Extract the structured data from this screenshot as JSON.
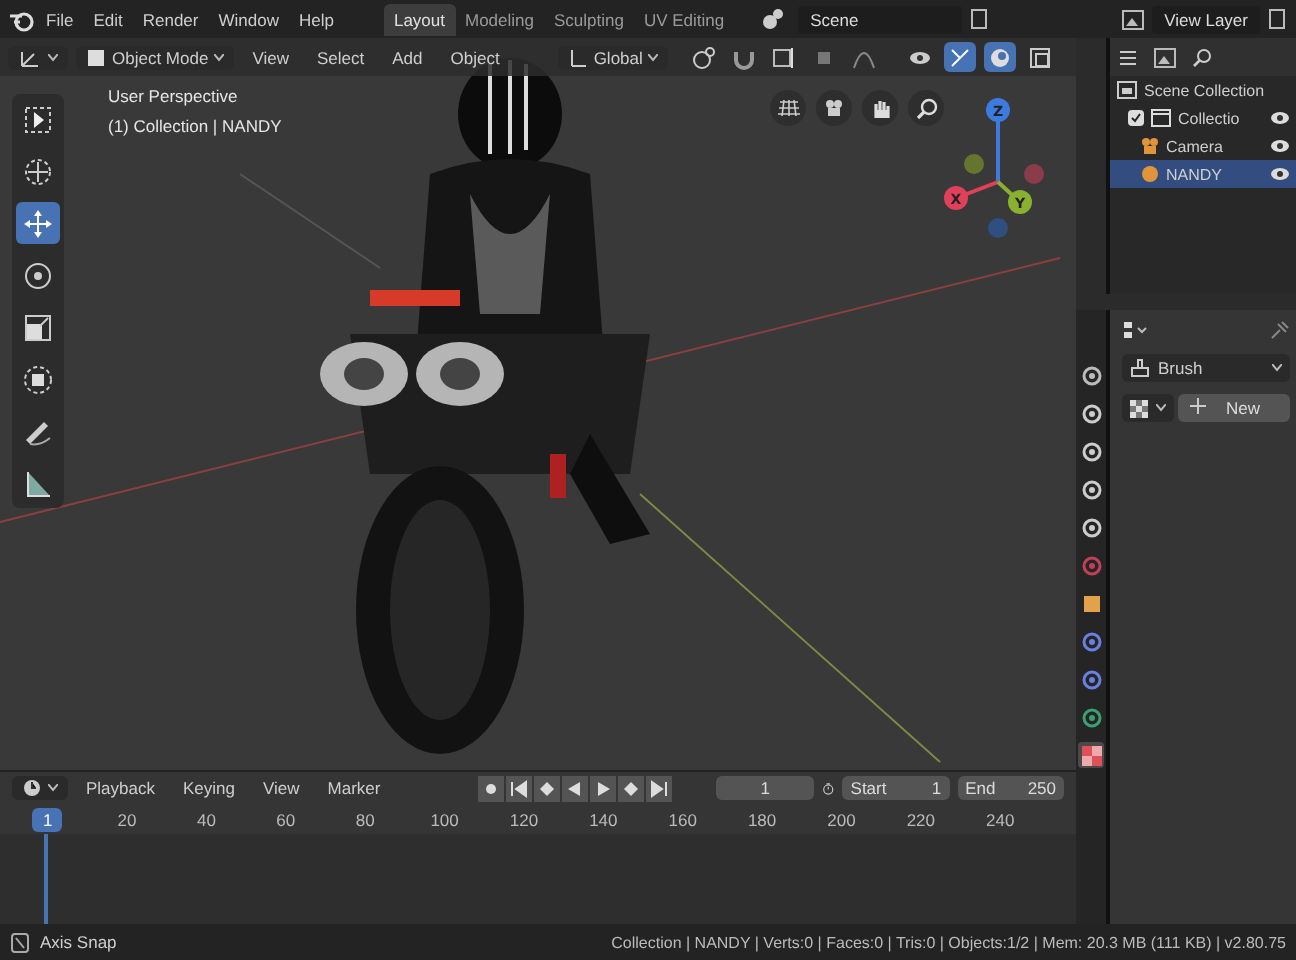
{
  "menu": [
    "File",
    "Edit",
    "Render",
    "Window",
    "Help"
  ],
  "workspace_tabs": [
    {
      "label": "Layout",
      "selected": true
    },
    {
      "label": "Modeling",
      "selected": false
    },
    {
      "label": "Sculpting",
      "selected": false
    },
    {
      "label": "UV Editing",
      "selected": false
    }
  ],
  "scene": "Scene",
  "view_layer": "View Layer",
  "viewport": {
    "mode": "Object Mode",
    "menus": [
      "View",
      "Select",
      "Add",
      "Object"
    ],
    "orientation": "Global",
    "tools": [
      {
        "kind": "select",
        "selected": false
      },
      {
        "kind": "cursor",
        "selected": false
      },
      {
        "kind": "move",
        "selected": true
      },
      {
        "kind": "rotate",
        "selected": false
      },
      {
        "kind": "scale",
        "selected": false
      },
      {
        "kind": "transform",
        "selected": false
      },
      {
        "kind": "annotate",
        "selected": false
      },
      {
        "kind": "measure",
        "selected": false
      }
    ],
    "overlay_lines": [
      "User Perspective",
      "(1) Collection | NANDY"
    ],
    "gizmo_axes": [
      "X",
      "Y",
      "Z"
    ]
  },
  "outliner": {
    "items": [
      {
        "label": "Scene Collection",
        "kind": "scene",
        "selected": false,
        "children": [
          {
            "label": "Collectio",
            "kind": "collection",
            "checked": true,
            "selected": false,
            "children": [
              {
                "label": "Camera",
                "kind": "camera",
                "selected": false
              },
              {
                "label": "NANDY",
                "kind": "object",
                "selected": true
              }
            ]
          }
        ]
      }
    ]
  },
  "properties": {
    "brush": "Brush",
    "new_button": "New",
    "tabs": [
      {
        "kind": "tool",
        "selected": false
      },
      {
        "kind": "render",
        "selected": false
      },
      {
        "kind": "output",
        "selected": false
      },
      {
        "kind": "view_layer",
        "selected": false
      },
      {
        "kind": "scene",
        "selected": false
      },
      {
        "kind": "world",
        "selected": false
      },
      {
        "kind": "object",
        "selected": false
      },
      {
        "kind": "particles",
        "selected": false
      },
      {
        "kind": "physics",
        "selected": false
      },
      {
        "kind": "constraints",
        "selected": false
      },
      {
        "kind": "texture",
        "selected": true
      }
    ]
  },
  "timeline": {
    "menus": [
      "Playback",
      "Keying",
      "View",
      "Marker"
    ],
    "current_frame": "1",
    "start_label": "Start",
    "start": "1",
    "end_label": "End",
    "end": "250",
    "ruler": [
      {
        "label": "1",
        "selected": true
      },
      {
        "label": "20",
        "selected": false
      },
      {
        "label": "40",
        "selected": false
      },
      {
        "label": "60",
        "selected": false
      },
      {
        "label": "80",
        "selected": false
      },
      {
        "label": "100",
        "selected": false
      },
      {
        "label": "120",
        "selected": false
      },
      {
        "label": "140",
        "selected": false
      },
      {
        "label": "160",
        "selected": false
      },
      {
        "label": "180",
        "selected": false
      },
      {
        "label": "200",
        "selected": false
      },
      {
        "label": "220",
        "selected": false
      },
      {
        "label": "240",
        "selected": false
      }
    ]
  },
  "status_bar": {
    "left": "Axis Snap",
    "right": "Collection | NANDY | Verts:0 | Faces:0 | Tris:0 | Objects:1/2 | Mem: 20.3 MB (111 KB) | v2.80.75"
  }
}
